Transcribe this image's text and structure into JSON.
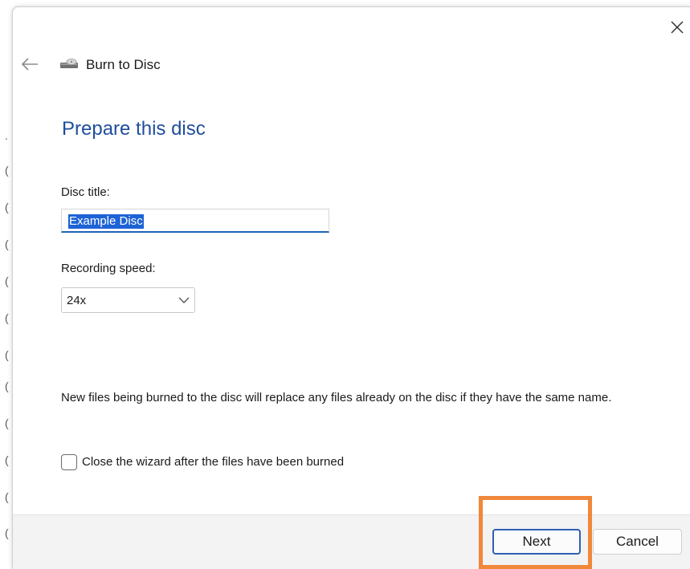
{
  "dialog": {
    "header_title": "Burn to Disc",
    "heading": "Prepare this disc",
    "disc_title_label": "Disc title:",
    "disc_title_value": "Example Disc",
    "recording_speed_label": "Recording speed:",
    "recording_speed_value": "24x",
    "info_text": "New files being burned to the disc will replace any files already on the disc if they have the same name.",
    "close_wizard_label": "Close the wizard after the files have been burned",
    "close_wizard_checked": false
  },
  "footer": {
    "next_label": "Next",
    "cancel_label": "Cancel"
  },
  "icons": {
    "close": "close-icon",
    "back": "back-arrow-icon",
    "disc": "disc-drive-icon",
    "dropdown": "chevron-down-icon"
  },
  "colors": {
    "heading": "#1f4e9c",
    "selection": "#1e63d6",
    "focus_border": "#2d5fb3",
    "highlight": "#f0873a",
    "footer_bg": "#f3f3f3"
  }
}
